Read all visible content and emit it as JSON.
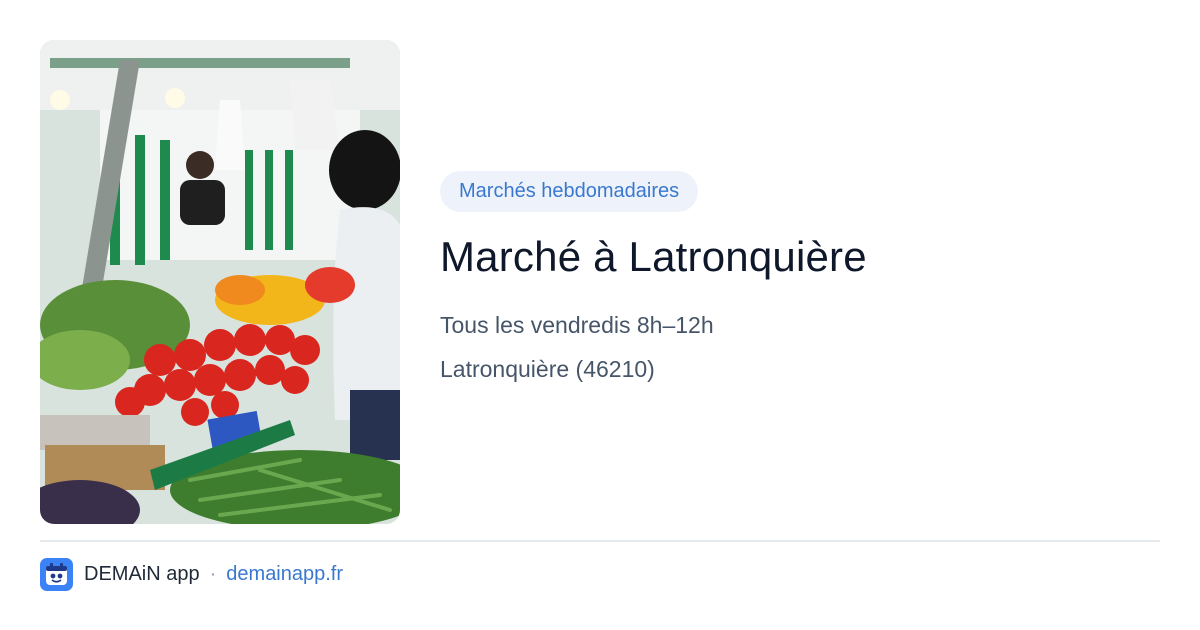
{
  "photo": {
    "alt": "Étal de fruits et légumes sur un marché"
  },
  "category_badge": "Marchés hebdomadaires",
  "title": "Marché à Latronquière",
  "schedule": "Tous les vendredis 8h–12h",
  "location": "Latronquière (46210)",
  "footer": {
    "brand": "DEMAiN app",
    "separator": "·",
    "url": "demainapp.fr",
    "logo_icon": "demain-logo-icon"
  },
  "colors": {
    "accent": "#3a78cf",
    "badge_bg": "#eef3fb",
    "title": "#0f172a",
    "subtext": "#475569",
    "divider": "#e5eaef"
  }
}
